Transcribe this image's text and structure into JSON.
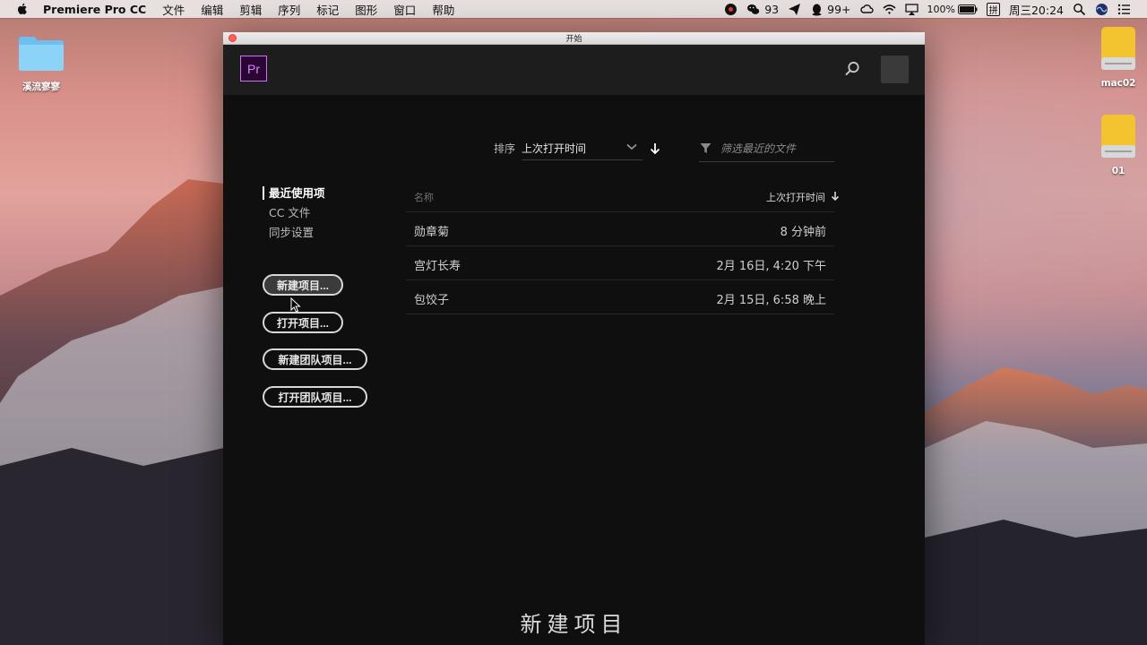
{
  "menubar": {
    "app_name": "Premiere Pro CC",
    "menus": [
      "文件",
      "编辑",
      "剪辑",
      "序列",
      "标记",
      "图形",
      "窗口",
      "帮助"
    ],
    "status": {
      "wechat_count": "93",
      "qq_count": "99+",
      "battery": "100%",
      "input_method": "拼",
      "clock": "周三20:24"
    }
  },
  "desktop": {
    "folder_label": "溪流寥寥",
    "drive1_label": "mac02",
    "drive2_label": "01"
  },
  "window": {
    "title": "开始",
    "logo_text": "Pr",
    "sort": {
      "label": "排序",
      "value": "上次打开时间"
    },
    "filter": {
      "placeholder": "筛选最近的文件"
    },
    "nav": {
      "recent": "最近使用项",
      "cc_files": "CC 文件",
      "sync": "同步设置"
    },
    "buttons": {
      "new_project": "新建项目...",
      "open_project": "打开项目...",
      "new_team_project": "新建团队项目...",
      "open_team_project": "打开团队项目..."
    },
    "list": {
      "col_name": "名称",
      "col_time": "上次打开时间",
      "rows": [
        {
          "name": "勋章菊",
          "time": "8 分钟前"
        },
        {
          "name": "宫灯长寿",
          "time": "2月 16日, 4:20 下午"
        },
        {
          "name": "包饺子",
          "time": "2月 15日, 6:58 晚上"
        }
      ]
    },
    "bottom_title": "新建项目"
  },
  "colors": {
    "premiere_purple": "#d36ff7",
    "window_bg": "#0f0f10",
    "header_bg": "#1d1d1e"
  },
  "icons": [
    "apple-icon",
    "search-icon",
    "filter-icon",
    "chevron-down-icon",
    "sort-arrow-icon",
    "folder-icon",
    "drive-icon",
    "wifi-icon",
    "battery-icon",
    "spotlight-icon",
    "siri-icon",
    "notification-icon"
  ]
}
